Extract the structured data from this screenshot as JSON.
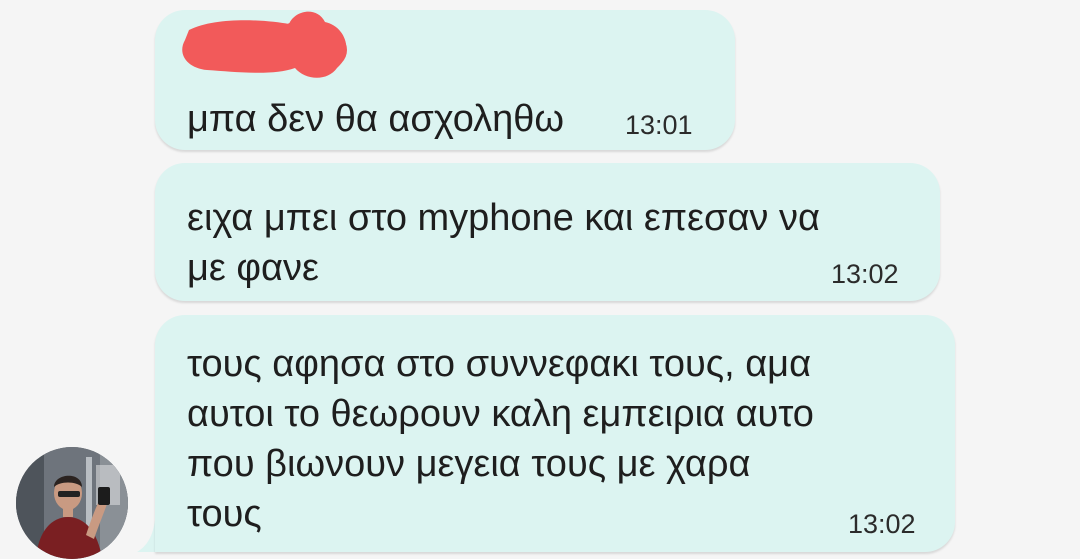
{
  "conversation": {
    "messages": [
      {
        "text": "μπα δεν θα ασχοληθω",
        "time": "13:01"
      },
      {
        "text": "ειχα μπει στο myphone και επεσαν να\nμε φανε",
        "time": "13:02"
      },
      {
        "text": "τους αφησα στο συννεφακι τους, αμα\nαυτοι το θεωρουν καλη εμπειρια αυτο\nπου βιωνουν μεγεια τους με χαρα\nτους",
        "time": "13:02"
      }
    ],
    "sender_avatar": "user-avatar-photo"
  },
  "colors": {
    "bubble_bg": "#dcf4f1",
    "background": "#f5f5f5",
    "redaction": "#f25a5a",
    "text": "#1e1e1e"
  }
}
